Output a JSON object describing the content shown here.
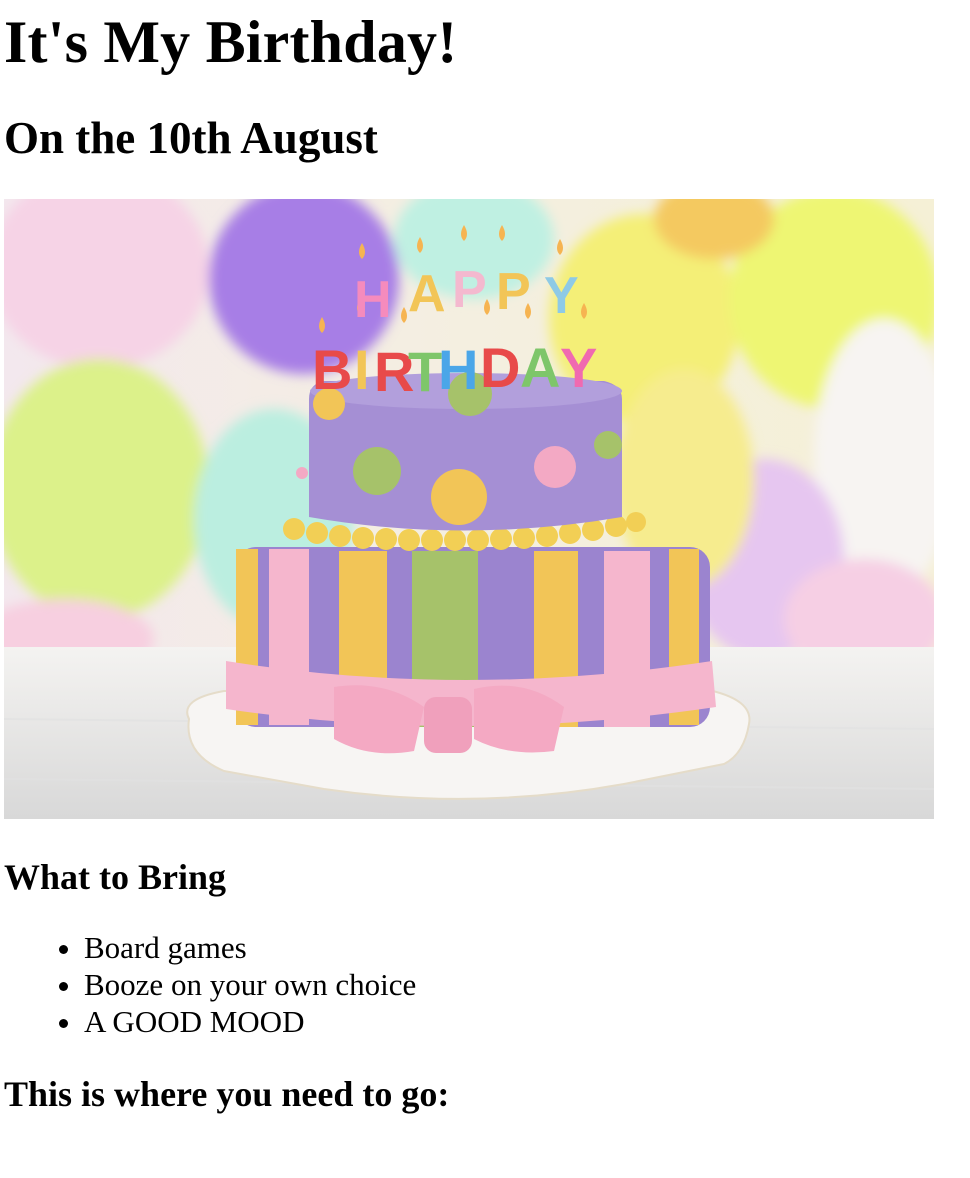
{
  "page": {
    "title": "It's My Birthday!",
    "subtitle": "On the 10th August",
    "image": {
      "candle_letters_top": [
        "H",
        "A",
        "P",
        "P",
        "Y"
      ],
      "candle_letters_bottom": [
        "B",
        "I",
        "R",
        "T",
        "H",
        "D",
        "A",
        "Y"
      ],
      "colors": {
        "cake_purple": "#9b84cf",
        "stripe_yellow": "#f2c557",
        "stripe_green": "#a6c26a",
        "ribbon_pink": "#f5b6cd",
        "dot_pink": "#f3a9c4"
      }
    },
    "bring_heading": "What to Bring",
    "bring_items": [
      "Board games",
      "Booze on your own choice",
      "A GOOD MOOD"
    ],
    "location_heading": "This is where you need to go:"
  }
}
